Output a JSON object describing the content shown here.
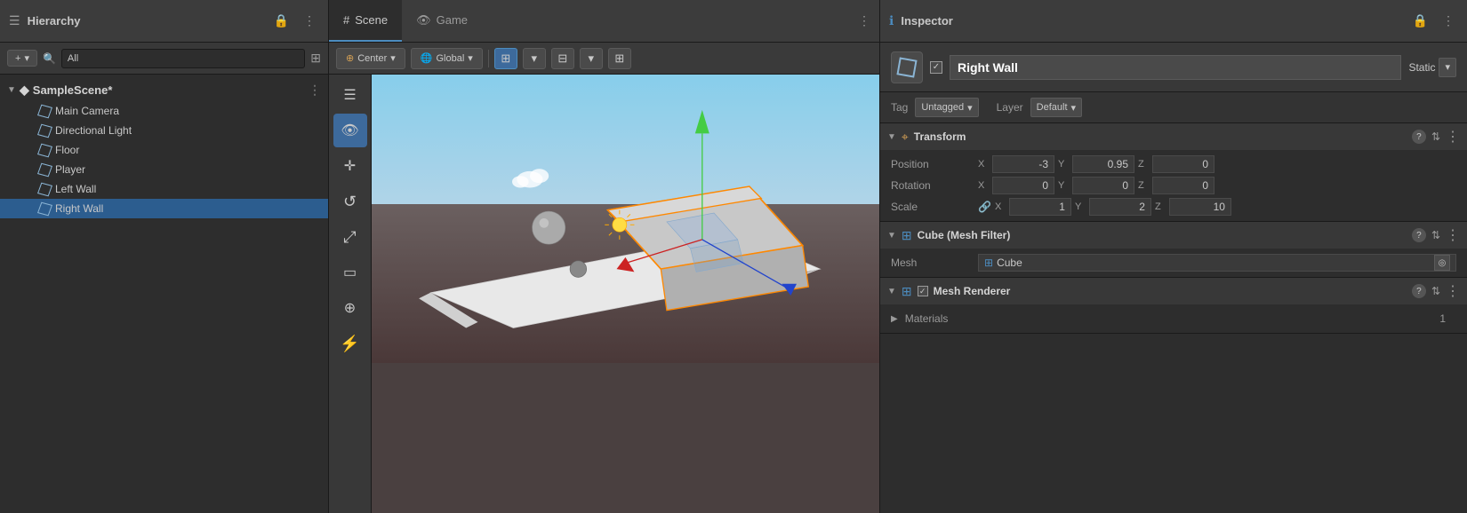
{
  "hierarchy": {
    "title": "Hierarchy",
    "lock_icon": "🔒",
    "more_icon": "⋮",
    "toolbar": {
      "add_label": "+",
      "add_arrow": "▾",
      "search_placeholder": "All",
      "search_icon": "🔍"
    },
    "scene_name": "SampleScene*",
    "scene_more": "⋮",
    "items": [
      {
        "label": "Main Camera",
        "indent": 2
      },
      {
        "label": "Directional Light",
        "indent": 2
      },
      {
        "label": "Floor",
        "indent": 2
      },
      {
        "label": "Player",
        "indent": 2
      },
      {
        "label": "Left Wall",
        "indent": 2
      },
      {
        "label": "Right Wall",
        "indent": 2,
        "selected": true
      }
    ]
  },
  "scene": {
    "tabs": [
      {
        "label": "Scene",
        "icon": "#",
        "active": true
      },
      {
        "label": "Game",
        "icon": "👁",
        "active": false
      }
    ],
    "more_icon": "⋮",
    "toolbar": {
      "center_label": "Center",
      "center_arrow": "▾",
      "global_label": "Global",
      "global_arrow": "▾"
    },
    "tools": [
      {
        "icon": "☰",
        "name": "menu",
        "active": false
      },
      {
        "icon": "👁",
        "name": "view",
        "active": true
      },
      {
        "icon": "✛",
        "name": "move",
        "active": false
      },
      {
        "icon": "↺",
        "name": "rotate",
        "active": false
      },
      {
        "icon": "⤢",
        "name": "scale",
        "active": false
      },
      {
        "icon": "▭",
        "name": "rect",
        "active": false
      },
      {
        "icon": "⊕",
        "name": "transform",
        "active": false
      },
      {
        "icon": "⚡",
        "name": "custom",
        "active": false
      }
    ]
  },
  "inspector": {
    "title": "Inspector",
    "lock_icon": "🔒",
    "more_icon": "⋮",
    "object": {
      "enabled": true,
      "name": "Right Wall",
      "static_label": "Static",
      "static_arrow": "▾",
      "tag_label": "Tag",
      "tag_value": "Untagged",
      "tag_arrow": "▾",
      "layer_label": "Layer",
      "layer_value": "Default",
      "layer_arrow": "▾"
    },
    "transform": {
      "title": "Transform",
      "expand": "▼",
      "help": "?",
      "more": "⋮",
      "position_label": "Position",
      "position_x": "-3",
      "position_y": "0.95",
      "position_z": "0",
      "rotation_label": "Rotation",
      "rotation_x": "0",
      "rotation_y": "0",
      "rotation_z": "0",
      "scale_label": "Scale",
      "scale_icon": "🔗",
      "scale_x": "1",
      "scale_y": "2",
      "scale_z": "10"
    },
    "mesh_filter": {
      "title": "Cube (Mesh Filter)",
      "expand": "▼",
      "help": "?",
      "more": "⋮",
      "mesh_label": "Mesh",
      "mesh_value": "Cube",
      "mesh_select": "◎"
    },
    "mesh_renderer": {
      "title": "Mesh Renderer",
      "expand": "▼",
      "enabled": true,
      "help": "?",
      "more": "⋮",
      "materials_label": "Materials",
      "materials_count": "1",
      "materials_expand": "▶"
    }
  }
}
